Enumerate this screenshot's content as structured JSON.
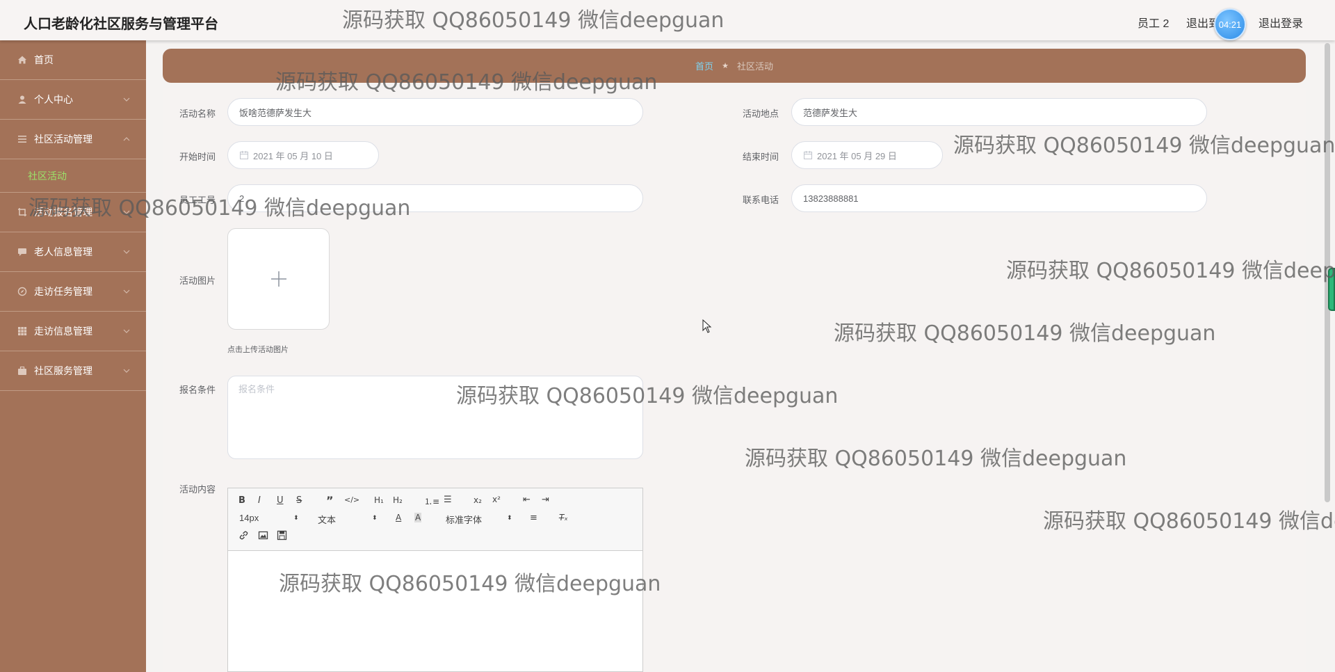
{
  "header": {
    "app_title": "人口老龄化社区服务与管理平台",
    "user_label": "员工 2",
    "exit_label_partial": "退出到前台",
    "timer": "04:21",
    "logout_label": "退出登录"
  },
  "sidebar": {
    "items": [
      {
        "label": "首页",
        "icon": "home-icon"
      },
      {
        "label": "个人中心",
        "icon": "user-icon"
      },
      {
        "label": "社区活动管理",
        "icon": "list-icon",
        "expanded": true
      },
      {
        "label": "活动报名管理",
        "icon": "crop-icon"
      },
      {
        "label": "老人信息管理",
        "icon": "message-icon"
      },
      {
        "label": "走访任务管理",
        "icon": "compass-icon"
      },
      {
        "label": "走访信息管理",
        "icon": "grid-icon"
      },
      {
        "label": "社区服务管理",
        "icon": "suitcase-icon"
      }
    ],
    "active_sub_item": "社区活动",
    "active_color": "#9be36a"
  },
  "breadcrumb": {
    "home": "首页",
    "current": "社区活动"
  },
  "form": {
    "activity_name_label": "活动名称",
    "activity_name_value": "饭啥范德萨发生大",
    "location_label": "活动地点",
    "location_value": "范德萨发生大",
    "start_time_label": "开始时间",
    "start_time_value": "2021 年 05 月 10 日",
    "end_time_label": "结束时间",
    "end_time_value": "2021 年 05 月 29 日",
    "employee_label": "员工工号",
    "employee_value": "2",
    "phone_label": "联系电话",
    "phone_value": "13823888881",
    "image_label": "活动图片",
    "upload_tip": "点击上传活动图片",
    "condition_label": "报名条件",
    "condition_placeholder": "报名条件",
    "content_label": "活动内容"
  },
  "editor": {
    "font_size": "14px",
    "header_select": "文本",
    "font_family": "标准字体"
  },
  "watermark": "源码获取 QQ86050149 微信deepguan",
  "colors": {
    "sidebar_bg": "#a37258",
    "breadcrumb_home": "#7ed2f0"
  }
}
